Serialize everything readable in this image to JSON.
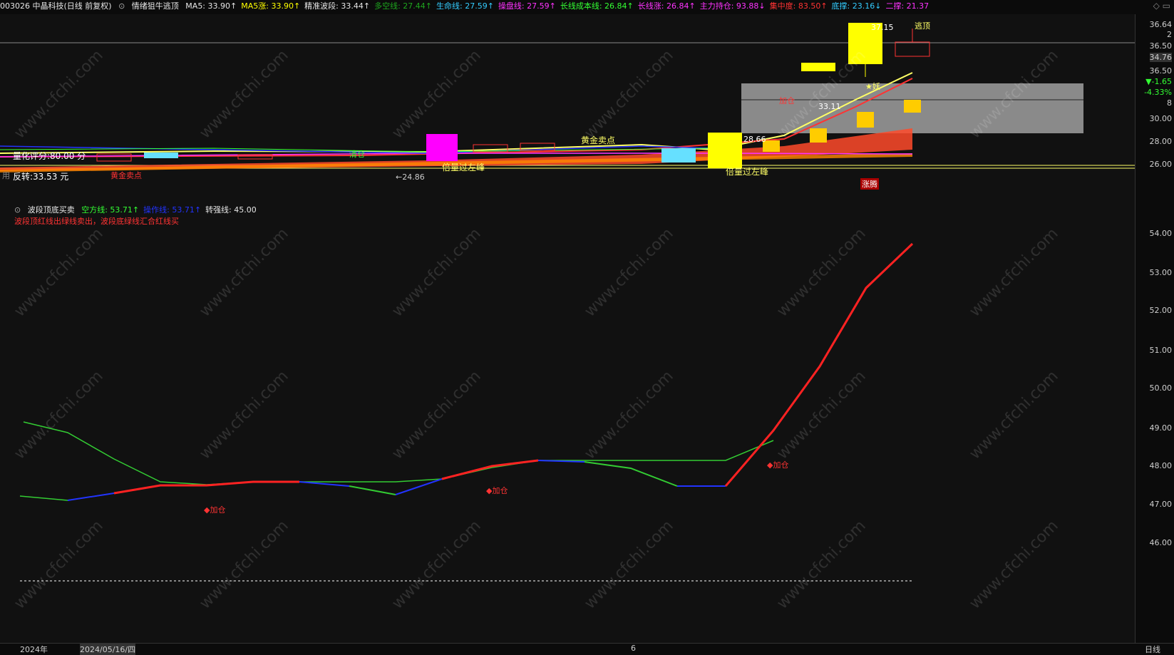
{
  "header": {
    "stock": "003026 中晶科技(日线 前复权)",
    "indicator_name": "情绪狙牛逃顶",
    "items": [
      {
        "label": "MA5: 33.90↑",
        "color": "#e6e6e6"
      },
      {
        "label": "MA5涨: 33.90↑",
        "color": "#ffff00"
      },
      {
        "label": "精准波段: 33.44↑",
        "color": "#e6e6e6"
      },
      {
        "label": "多空线: 27.44↑",
        "color": "#1ea51e"
      },
      {
        "label": "生命线: 27.59↑",
        "color": "#33ccff"
      },
      {
        "label": "操盘线: 27.59↑",
        "color": "#ff33ff"
      },
      {
        "label": "长线成本线: 26.84↑",
        "color": "#33ff33"
      },
      {
        "label": "长线涨: 26.84↑",
        "color": "#ff33ff"
      },
      {
        "label": "主力持仓: 93.88↓",
        "color": "#ff33ff"
      },
      {
        "label": "集中度: 83.50↑",
        "color": "#ff3333"
      },
      {
        "label": "底撑: 23.16↓",
        "color": "#33ccff"
      },
      {
        "label": "二撑: 21.37",
        "color": "#ff33ff"
      }
    ]
  },
  "panel1": {
    "labels": {
      "score": "量化评分:80.00 分",
      "reversal": "反转:33.53 元",
      "use": "用",
      "low_price": "←24.86",
      "gold_sell_1": "黄金卖点",
      "gold_sell_2": "黄金卖点",
      "clear": "清仓",
      "double_peak_1": "倍量过左峰",
      "double_peak_2": "倍量过左峰",
      "add_pos": "加仓",
      "price_28": "28.66",
      "price_33": "33.11",
      "price_37": "37.15",
      "yao": "★妖",
      "surge": "涨腾",
      "escape": "逃顶"
    }
  },
  "panel2": {
    "title": "波段顶底买卖",
    "lines": [
      {
        "label": "空方线: 53.71↑",
        "color": "#33ff33"
      },
      {
        "label": "操作线: 53.71↑",
        "color": "#2233ff"
      },
      {
        "label": "转强线: 45.00",
        "color": "#e6e6e6"
      }
    ],
    "note": "波段顶红线出绿线卖出，波段底绿线汇合红线买",
    "add_label": "加仓"
  },
  "right_axis": {
    "upper": [
      "36.64",
      "2",
      "36.50",
      "34.76",
      "36.50",
      "▼-1.65",
      "-4.33%",
      "8",
      "30.00",
      "28.00",
      "26.00"
    ],
    "lower": [
      "54.00",
      "53.00",
      "52.00",
      "51.00",
      "50.00",
      "49.00",
      "48.00",
      "47.00",
      "46.00"
    ]
  },
  "bottom": {
    "ticks": [
      "2024年",
      "2024/05/16/四",
      "6",
      "日线"
    ]
  },
  "watermark": "www.cfchi.com"
}
